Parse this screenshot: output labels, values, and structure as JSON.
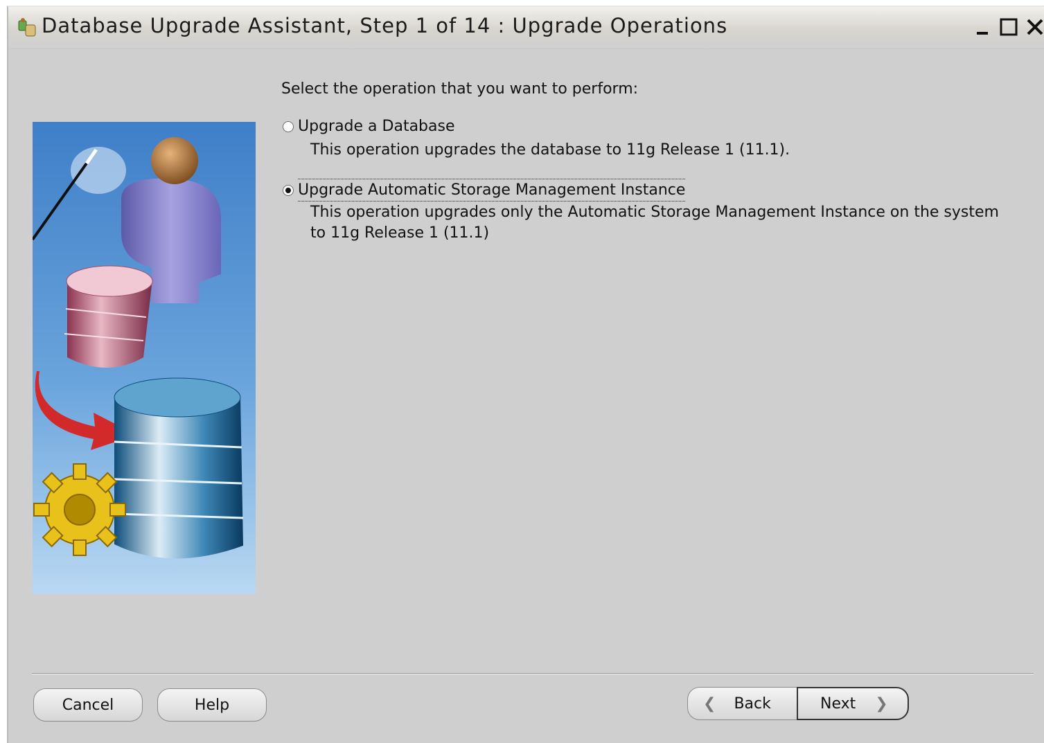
{
  "window": {
    "title": "Database Upgrade Assistant, Step 1 of 14 : Upgrade Operations",
    "controls": {
      "minimize": "minimize",
      "maximize": "maximize",
      "close": "close"
    }
  },
  "main": {
    "prompt": "Select the operation that you want to perform:",
    "options": [
      {
        "label": "Upgrade a Database",
        "description": "This operation upgrades the database to 11g Release 1 (11.1).",
        "selected": false
      },
      {
        "label": "Upgrade Automatic Storage Management Instance",
        "description_line1": "This operation upgrades only the Automatic Storage Management Instance on the system",
        "description_line2": "to 11g Release 1 (11.1)",
        "selected": true
      }
    ]
  },
  "footer": {
    "cancel_label": "Cancel",
    "help_label": "Help",
    "back_label": "Back",
    "next_label": "Next"
  },
  "icons": {
    "app": "database-upgrade-app-icon",
    "back": "chevron-left-icon",
    "next": "chevron-right-icon"
  },
  "colors": {
    "window_bg": "#cfcfcf",
    "illustration_sky": "#4d8fd0"
  }
}
